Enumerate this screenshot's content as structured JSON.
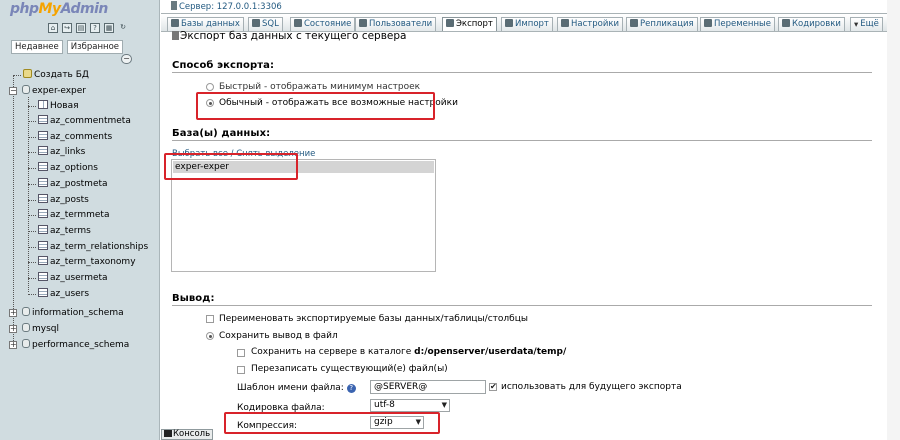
{
  "nav": {
    "logo": {
      "part1": "php",
      "part2": "My",
      "part3": "Admin"
    },
    "icons": [
      "home-icon",
      "exit-icon",
      "query-window-icon",
      "docs-icon",
      "settings-icon",
      "reload-icon"
    ],
    "tabs": [
      "Недавнее",
      "Избранное"
    ],
    "tree": {
      "new_db": "Создать БД",
      "db_main": "exper-exper",
      "new_table": "Новая",
      "tables": [
        "az_commentmeta",
        "az_comments",
        "az_links",
        "az_options",
        "az_postmeta",
        "az_posts",
        "az_termmeta",
        "az_terms",
        "az_term_relationships",
        "az_term_taxonomy",
        "az_usermeta",
        "az_users"
      ],
      "other_dbs": [
        "information_schema",
        "mysql",
        "performance_schema"
      ]
    }
  },
  "breadcrumb": {
    "server": "Сервер: 127.0.0.1:3306"
  },
  "menu": {
    "tabs": [
      "Базы данных",
      "SQL",
      "Состояние",
      "Пользователи",
      "Экспорт",
      "Импорт",
      "Настройки",
      "Репликация",
      "Переменные",
      "Кодировки",
      "Ещё"
    ],
    "active": "Экспорт"
  },
  "page": {
    "title": "Экспорт баз данных с текущего сервера",
    "export_method": {
      "heading": "Способ экспорта:",
      "options": [
        "Быстрый - отображать минимум настроек",
        "Обычный - отображать все возможные настройки"
      ],
      "selected": 1
    },
    "databases": {
      "heading": "База(ы) данных:",
      "select_all": "Выбрать все",
      "separator": " / ",
      "unselect_all": "Снять выделение",
      "items": [
        "exper-exper"
      ],
      "selected_item": "exper-exper"
    },
    "output": {
      "heading": "Вывод:",
      "rename_label": "Переименовать экспортируемые базы данных/таблицы/столбцы",
      "rename_checked": false,
      "save_to_file_label": "Сохранить вывод в файл",
      "save_on_server_label": "Сохранить на сервере в каталоге",
      "save_on_server_path": "d:/openserver/userdata/temp/",
      "overwrite_label": "Перезаписать существующий(е) файл(ы)",
      "filename_template_label": "Шаблон имени файла:",
      "filename_template_value": "@SERVER@",
      "remember_template_label": "использовать для будущего экспорта",
      "remember_template_checked": true,
      "charset_label": "Кодировка файла:",
      "charset_value": "utf-8",
      "compression_label": "Компрессия:",
      "compression_value": "gzip"
    }
  },
  "console": {
    "label": "Консоль"
  },
  "colors": {
    "accent_link": "#235a81",
    "highlight_red": "#d8232a",
    "nav_bg": "#d0dce0"
  }
}
